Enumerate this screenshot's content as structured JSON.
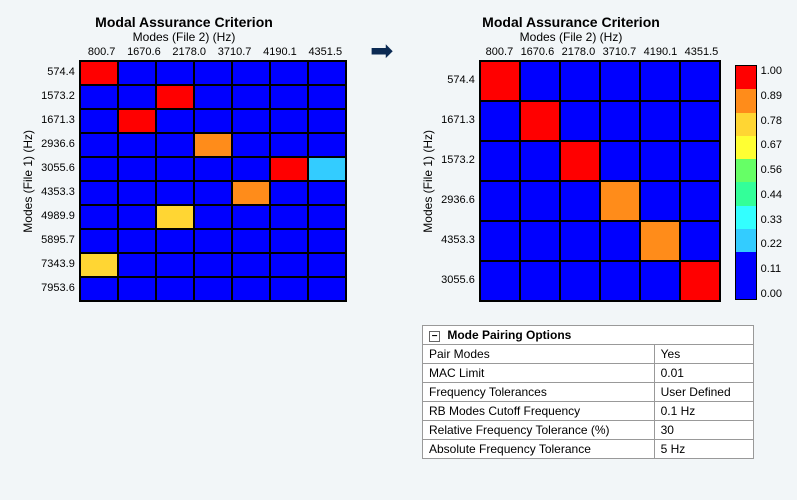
{
  "chart_data": [
    {
      "type": "heatmap",
      "title": "Modal Assurance Criterion",
      "subtitle": "Modes (File 2) (Hz)",
      "xlabel": "Modes (File 2) (Hz)",
      "ylabel": "Modes (File 1) (Hz)",
      "x_ticks": [
        "800.7",
        "1670.6",
        "2178.0",
        "3710.7",
        "4190.1",
        "4351.5"
      ],
      "y_ticks": [
        "574.4",
        "1573.2",
        "1671.3",
        "2936.6",
        "3055.6",
        "4353.3",
        "4989.9",
        "5895.7",
        "7343.9",
        "7953.6"
      ],
      "grid_cols": 7,
      "grid_rows": 10,
      "cells": [
        {
          "r": 0,
          "c": 0,
          "v": 0.95
        },
        {
          "r": 1,
          "c": 2,
          "v": 0.95
        },
        {
          "r": 2,
          "c": 1,
          "v": 0.95
        },
        {
          "r": 3,
          "c": 3,
          "v": 0.82
        },
        {
          "r": 4,
          "c": 5,
          "v": 0.95
        },
        {
          "r": 4,
          "c": 6,
          "v": 0.2
        },
        {
          "r": 5,
          "c": 4,
          "v": 0.82
        },
        {
          "r": 6,
          "c": 2,
          "v": 0.7
        },
        {
          "r": 8,
          "c": 0,
          "v": 0.7
        }
      ]
    },
    {
      "type": "heatmap",
      "title": "Modal Assurance Criterion",
      "subtitle": "Modes (File 2) (Hz)",
      "xlabel": "Modes (File 2) (Hz)",
      "ylabel": "Modes (File 1) (Hz)",
      "x_ticks": [
        "800.7",
        "1670.6",
        "2178.0",
        "3710.7",
        "4190.1",
        "4351.5"
      ],
      "y_ticks": [
        "574.4",
        "1671.3",
        "1573.2",
        "2936.6",
        "4353.3",
        "3055.6"
      ],
      "grid_cols": 6,
      "grid_rows": 6,
      "cells": [
        {
          "r": 0,
          "c": 0,
          "v": 0.95
        },
        {
          "r": 1,
          "c": 1,
          "v": 0.95
        },
        {
          "r": 2,
          "c": 2,
          "v": 0.95
        },
        {
          "r": 3,
          "c": 3,
          "v": 0.82
        },
        {
          "r": 4,
          "c": 4,
          "v": 0.82
        },
        {
          "r": 5,
          "c": 5,
          "v": 0.95
        }
      ]
    }
  ],
  "colorbar": {
    "ticks": [
      "1.00",
      "0.89",
      "0.78",
      "0.67",
      "0.56",
      "0.44",
      "0.33",
      "0.22",
      "0.11",
      "0.00"
    ],
    "colors": [
      "#ff0000",
      "#ff8c1a",
      "#ffd633",
      "#ffff33",
      "#66ff66",
      "#33ff99",
      "#33ffff",
      "#33ccff",
      "#0000ff",
      "#0000ff"
    ]
  },
  "options": {
    "header": "Mode Pairing Options",
    "collapse": "−",
    "rows": [
      {
        "label": "Pair Modes",
        "value": "Yes"
      },
      {
        "label": "MAC Limit",
        "value": "0.01"
      },
      {
        "label": "Frequency Tolerances",
        "value": "User Defined"
      },
      {
        "label": "RB Modes Cutoff Frequency",
        "value": "0.1 Hz"
      },
      {
        "label": "Relative Frequency Tolerance (%)",
        "value": "30"
      },
      {
        "label": "Absolute Frequency Tolerance",
        "value": "5 Hz"
      }
    ]
  },
  "value_color_scale": [
    {
      "min": 0.89,
      "color": "#ff0000"
    },
    {
      "min": 0.78,
      "color": "#ff8c1a"
    },
    {
      "min": 0.67,
      "color": "#ffd633"
    },
    {
      "min": 0.56,
      "color": "#ffff33"
    },
    {
      "min": 0.44,
      "color": "#66ff66"
    },
    {
      "min": 0.33,
      "color": "#33ff99"
    },
    {
      "min": 0.22,
      "color": "#33ffff"
    },
    {
      "min": 0.11,
      "color": "#33ccff"
    },
    {
      "min": 0.0,
      "color": "#0000ff"
    }
  ]
}
